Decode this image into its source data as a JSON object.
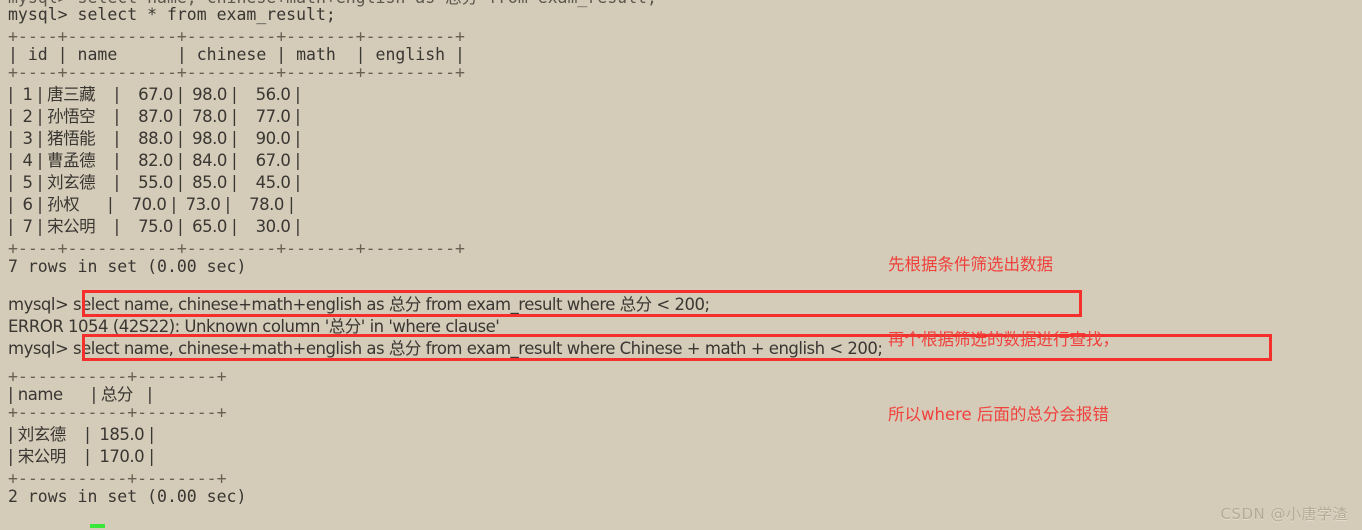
{
  "terminal": {
    "background_color": "#d4ccb9",
    "foreground_color": "#3a3632",
    "annotation_color": "#f0413c",
    "cursor_color": "#39e639",
    "scrolled_off_line": "mysql> select name, chinese+math+english as 总分 from exam_result;",
    "prompt": "mysql>",
    "lines": {
      "cmd1": "mysql> select * from exam_result;",
      "sep1": "+----+-----------+---------+-------+---------+",
      "header1": "| id | name      | chinese | math  | english |",
      "sep2": "+----+-----------+---------+-------+---------+",
      "row1": "|  1 | 唐三藏    |    67.0 |  98.0 |    56.0 |",
      "row2": "|  2 | 孙悟空    |    87.0 |  78.0 |    77.0 |",
      "row3": "|  3 | 猪悟能    |    88.0 |  98.0 |    90.0 |",
      "row4": "|  4 | 曹孟德    |    82.0 |  84.0 |    67.0 |",
      "row5": "|  5 | 刘玄德    |    55.0 |  85.0 |    45.0 |",
      "row6": "|  6 | 孙权      |    70.0 |  73.0 |    78.0 |",
      "row7": "|  7 | 宋公明    |    75.0 |  65.0 |    30.0 |",
      "sep3": "+----+-----------+---------+-------+---------+",
      "status1": "7 rows in set (0.00 sec)",
      "blank1": "",
      "cmd2": "mysql> select name, chinese+math+english as 总分 from exam_result where 总分 < 200;",
      "error1": "ERROR 1054 (42S22): Unknown column '总分' in 'where clause'",
      "cmd3": "mysql> select name, chinese+math+english as 总分 from exam_result where Chinese + math + english < 200;",
      "sep4": "+-----------+--------+",
      "header2": "| name      | 总分   |",
      "sep5": "+-----------+--------+",
      "row8": "| 刘玄德    |  185.0 |",
      "row9": "| 宋公明    |  170.0 |",
      "sep6": "+-----------+--------+",
      "status2": "2 rows in set (0.00 sec)"
    }
  },
  "queries": {
    "failing_query": "select name, chinese+math+english as 总分 from exam_result where 总分 < 200;",
    "working_query": "select name, chinese+math+english as 总分 from exam_result where Chinese + math + english < 200;",
    "error_code": "ERROR 1054 (42S22)",
    "error_message": "Unknown column '总分' in 'where clause'"
  },
  "annotation": {
    "line1": "先根据条件筛选出数据",
    "line2": "再个根据筛选的数据进行查找，",
    "line3": "所以where 后面的总分会报错"
  },
  "watermark": {
    "text": "CSDN @小唐学渣"
  },
  "table_result_1": {
    "columns": [
      "id",
      "name",
      "chinese",
      "math",
      "english"
    ],
    "rows": [
      [
        "1",
        "唐三藏",
        "67.0",
        "98.0",
        "56.0"
      ],
      [
        "2",
        "孙悟空",
        "87.0",
        "78.0",
        "77.0"
      ],
      [
        "3",
        "猪悟能",
        "88.0",
        "98.0",
        "90.0"
      ],
      [
        "4",
        "曹孟德",
        "82.0",
        "84.0",
        "67.0"
      ],
      [
        "5",
        "刘玄德",
        "55.0",
        "85.0",
        "45.0"
      ],
      [
        "6",
        "孙权",
        "70.0",
        "73.0",
        "78.0"
      ],
      [
        "7",
        "宋公明",
        "75.0",
        "65.0",
        "30.0"
      ]
    ],
    "row_count_text": "7 rows in set (0.00 sec)"
  },
  "table_result_2": {
    "columns": [
      "name",
      "总分"
    ],
    "rows": [
      [
        "刘玄德",
        "185.0"
      ],
      [
        "宋公明",
        "170.0"
      ]
    ],
    "row_count_text": "2 rows in set (0.00 sec)"
  }
}
